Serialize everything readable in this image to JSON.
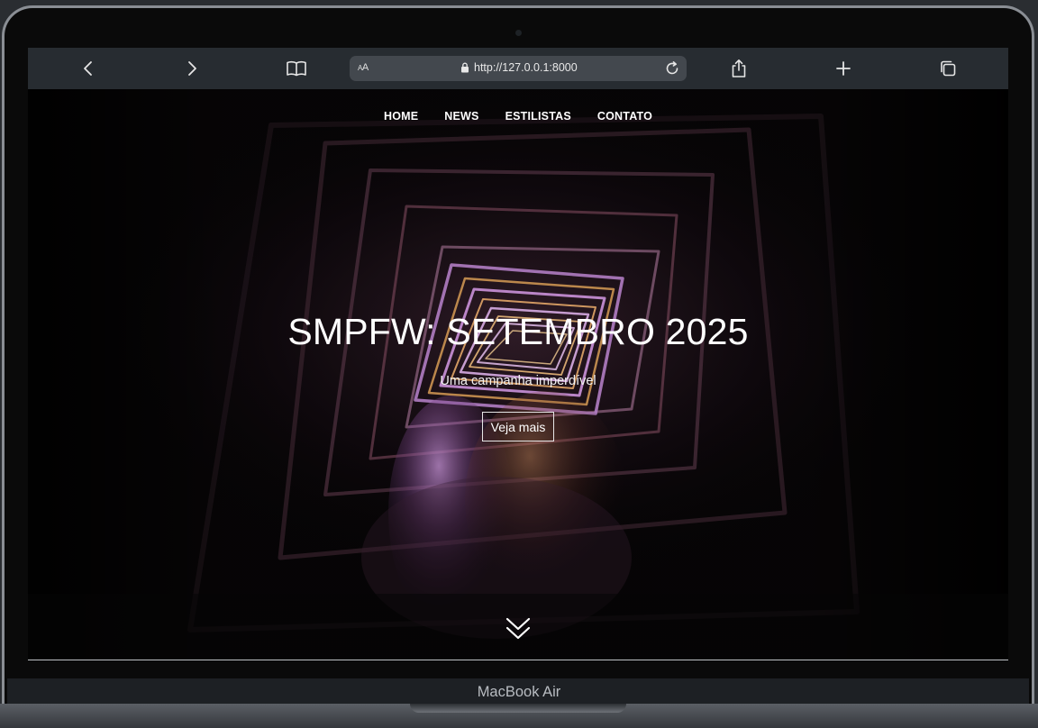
{
  "device": {
    "brand_label": "MacBook Air"
  },
  "browser": {
    "text_size_label": "AA",
    "url": "http://127.0.0.1:8000"
  },
  "nav": {
    "items": [
      {
        "label": "HOME"
      },
      {
        "label": "NEWS"
      },
      {
        "label": "ESTILISTAS"
      },
      {
        "label": "CONTATO"
      }
    ]
  },
  "hero": {
    "title": "SMPFW: SETEMBRO 2025",
    "subtitle": "Uma campanha imperdível",
    "cta_label": "Veja mais"
  },
  "colors": {
    "toolbar": "#272c31",
    "address_bar": "#43484e",
    "accent_purple": "#b77fd0",
    "accent_orange": "#e39a45"
  }
}
